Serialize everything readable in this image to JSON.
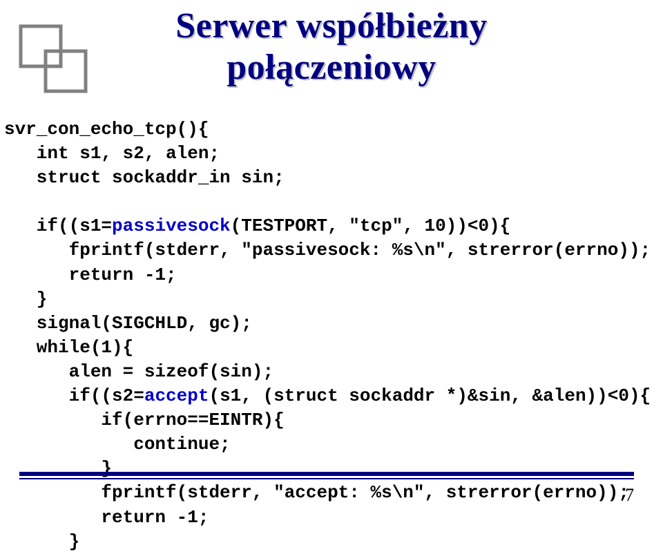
{
  "title": {
    "line1": "Serwer współbieżny",
    "line2": "połączeniowy"
  },
  "code": {
    "l1": "svr_con_echo_tcp(){",
    "l2": "   int s1, s2, alen;",
    "l3": "   struct sockaddr_in sin;",
    "l4": "",
    "l5a": "   if((s1=",
    "l5b": "passivesock",
    "l5c": "(TESTPORT, \"tcp\", 10))<0){",
    "l6": "      fprintf(stderr, \"passivesock: %s\\n\", strerror(errno));",
    "l7": "      return -1;",
    "l8": "   }",
    "l9": "   signal(SIGCHLD, gc);",
    "l10": "   while(1){",
    "l11": "      alen = sizeof(sin);",
    "l12a": "      if((s2=",
    "l12b": "accept",
    "l12c": "(s1, (struct sockaddr *)&sin, &alen))<0){",
    "l13": "         if(errno==EINTR){",
    "l14": "            continue;",
    "l15": "         }",
    "l16": "         fprintf(stderr, \"accept: %s\\n\", strerror(errno));",
    "l17": "         return -1;",
    "l18": "      }"
  },
  "page_number": "7"
}
